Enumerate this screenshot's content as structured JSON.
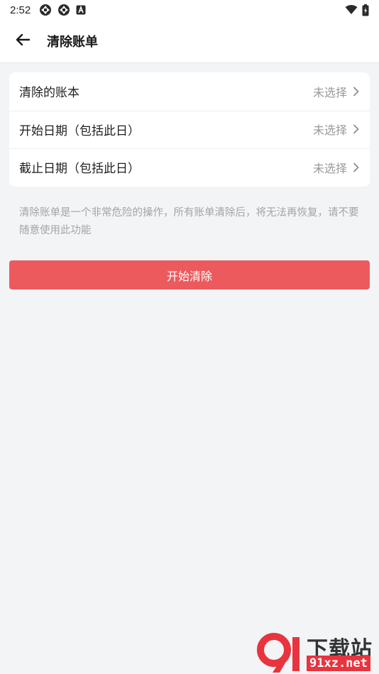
{
  "status_bar": {
    "time": "2:52",
    "icons": [
      "aperture-icon",
      "aperture-icon",
      "a-box-icon",
      "wifi-icon",
      "battery-charging-icon"
    ]
  },
  "app_bar": {
    "title": "清除账单",
    "back_icon": "arrow-left-icon"
  },
  "settings": {
    "rows": [
      {
        "label": "清除的账本",
        "value": "未选择"
      },
      {
        "label": "开始日期（包括此日）",
        "value": "未选择"
      },
      {
        "label": "截止日期（包括此日）",
        "value": "未选择"
      }
    ]
  },
  "hint": "清除账单是一个非常危险的操作，所有账单清除后，将无法再恢复，请不要随意使用此功能",
  "primary_button": {
    "label": "开始清除",
    "color": "#ec5a5e"
  },
  "watermark": {
    "title": "下载站",
    "site": "91xz.net",
    "accent": "#e8343f"
  }
}
